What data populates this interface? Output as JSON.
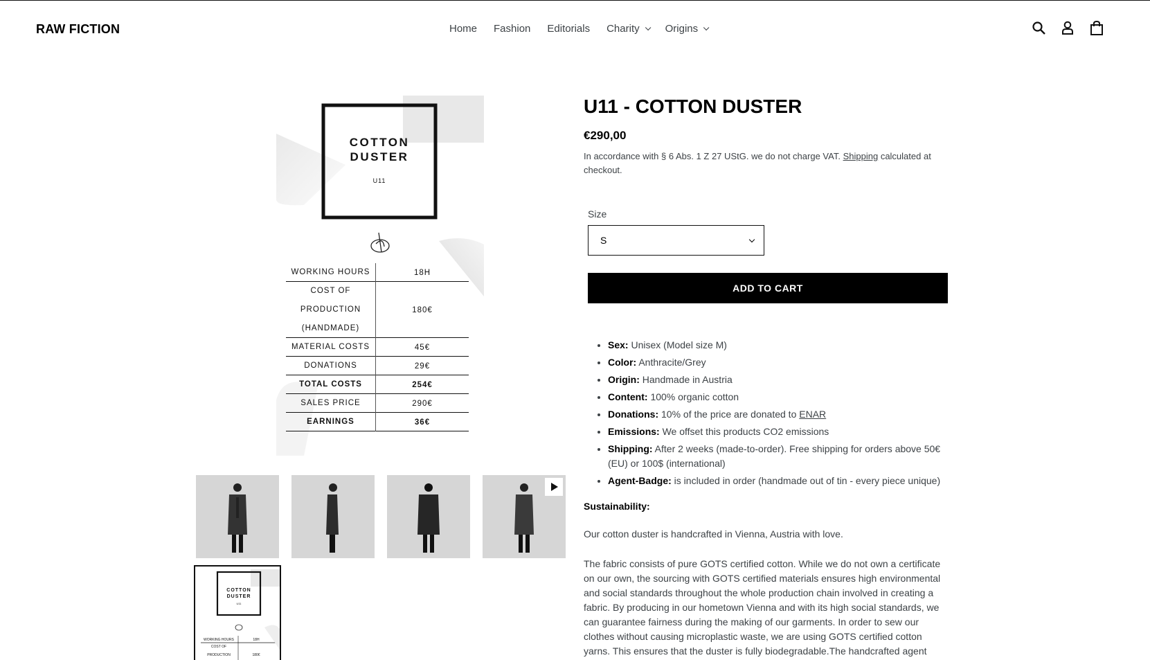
{
  "store": {
    "name": "RAW FICTION"
  },
  "nav": [
    {
      "label": "Home",
      "has_dropdown": false
    },
    {
      "label": "Fashion",
      "has_dropdown": false
    },
    {
      "label": "Editorials",
      "has_dropdown": false
    },
    {
      "label": "Charity",
      "has_dropdown": true
    },
    {
      "label": "Origins",
      "has_dropdown": true
    }
  ],
  "header_icons": [
    "search-icon",
    "account-icon",
    "cart-icon"
  ],
  "product": {
    "title": "U11 - COTTON DUSTER",
    "price": "€290,00",
    "vat_before": "In accordance with § 6 Abs. 1 Z 27 UStG. we do not charge VAT.",
    "vat_link": "Shipping",
    "vat_after": "calculated at checkout.",
    "size_label": "Size",
    "size_value": "S",
    "add_to_cart": "ADD TO CART"
  },
  "image_card": {
    "heading_line1": "COTTON",
    "heading_line2": "DUSTER",
    "code": "U11",
    "rows": [
      {
        "label": "WORKING HOURS",
        "value": "18H",
        "bold": false
      },
      {
        "label": "COST OF PRODUCTION (HANDMADE)",
        "label_lines": [
          "COST OF",
          "PRODUCTION",
          "(HANDMADE)"
        ],
        "value": "180€",
        "bold": false
      },
      {
        "label": "MATERIAL COSTS",
        "value": "45€",
        "bold": false
      },
      {
        "label": "DONATIONS",
        "value": "29€",
        "bold": false
      },
      {
        "label": "TOTAL COSTS",
        "value": "254€",
        "bold": true
      },
      {
        "label": "SALES PRICE",
        "value": "290€",
        "bold": false
      },
      {
        "label": "EARNINGS",
        "value": "36€",
        "bold": true
      }
    ]
  },
  "thumbnails": [
    {
      "alt": "front view",
      "video": false
    },
    {
      "alt": "side view",
      "video": false
    },
    {
      "alt": "back view",
      "video": false
    },
    {
      "alt": "video",
      "video": true
    },
    {
      "alt": "cost card",
      "video": false,
      "selected": true
    }
  ],
  "details": [
    {
      "key": "Sex:",
      "value": "Unisex (Model size M)"
    },
    {
      "key": "Color:",
      "value": "Anthracite/Grey"
    },
    {
      "key": "Origin:",
      "value": "Handmade in Austria"
    },
    {
      "key": "Content:",
      "value": "100% organic cotton"
    },
    {
      "key": "Donations:",
      "value": "10% of the price are donated to",
      "link": "ENAR"
    },
    {
      "key": "Emissions:",
      "value": "We offset this products CO2 emissions"
    },
    {
      "key": "Shipping:",
      "value": "After 2 weeks (made-to-order). Free shipping for orders above 50€ (EU) or 100$ (international)"
    },
    {
      "key": "Agent-Badge:",
      "value": "is included in order (handmade out of tin - every piece unique)"
    }
  ],
  "sustainability": {
    "title": "Sustainability:",
    "p1": "Our cotton duster is handcrafted in Vienna, Austria with love.",
    "p2": "The fabric consists of pure GOTS certified cotton. While we do not own a certificate on our own, the sourcing with GOTS certified materials ensures high environmental and social standards throughout the whole production chain involved in creating a fabric. By producing in our hometown Vienna and with its high social standards, we can guarantee fairness during the making of our garments. In order to sew our clothes without causing microplastic waste, we are using GOTS certified cotton yarns. This ensures that the duster is fully biodegradable.The handcrafted agent"
  }
}
